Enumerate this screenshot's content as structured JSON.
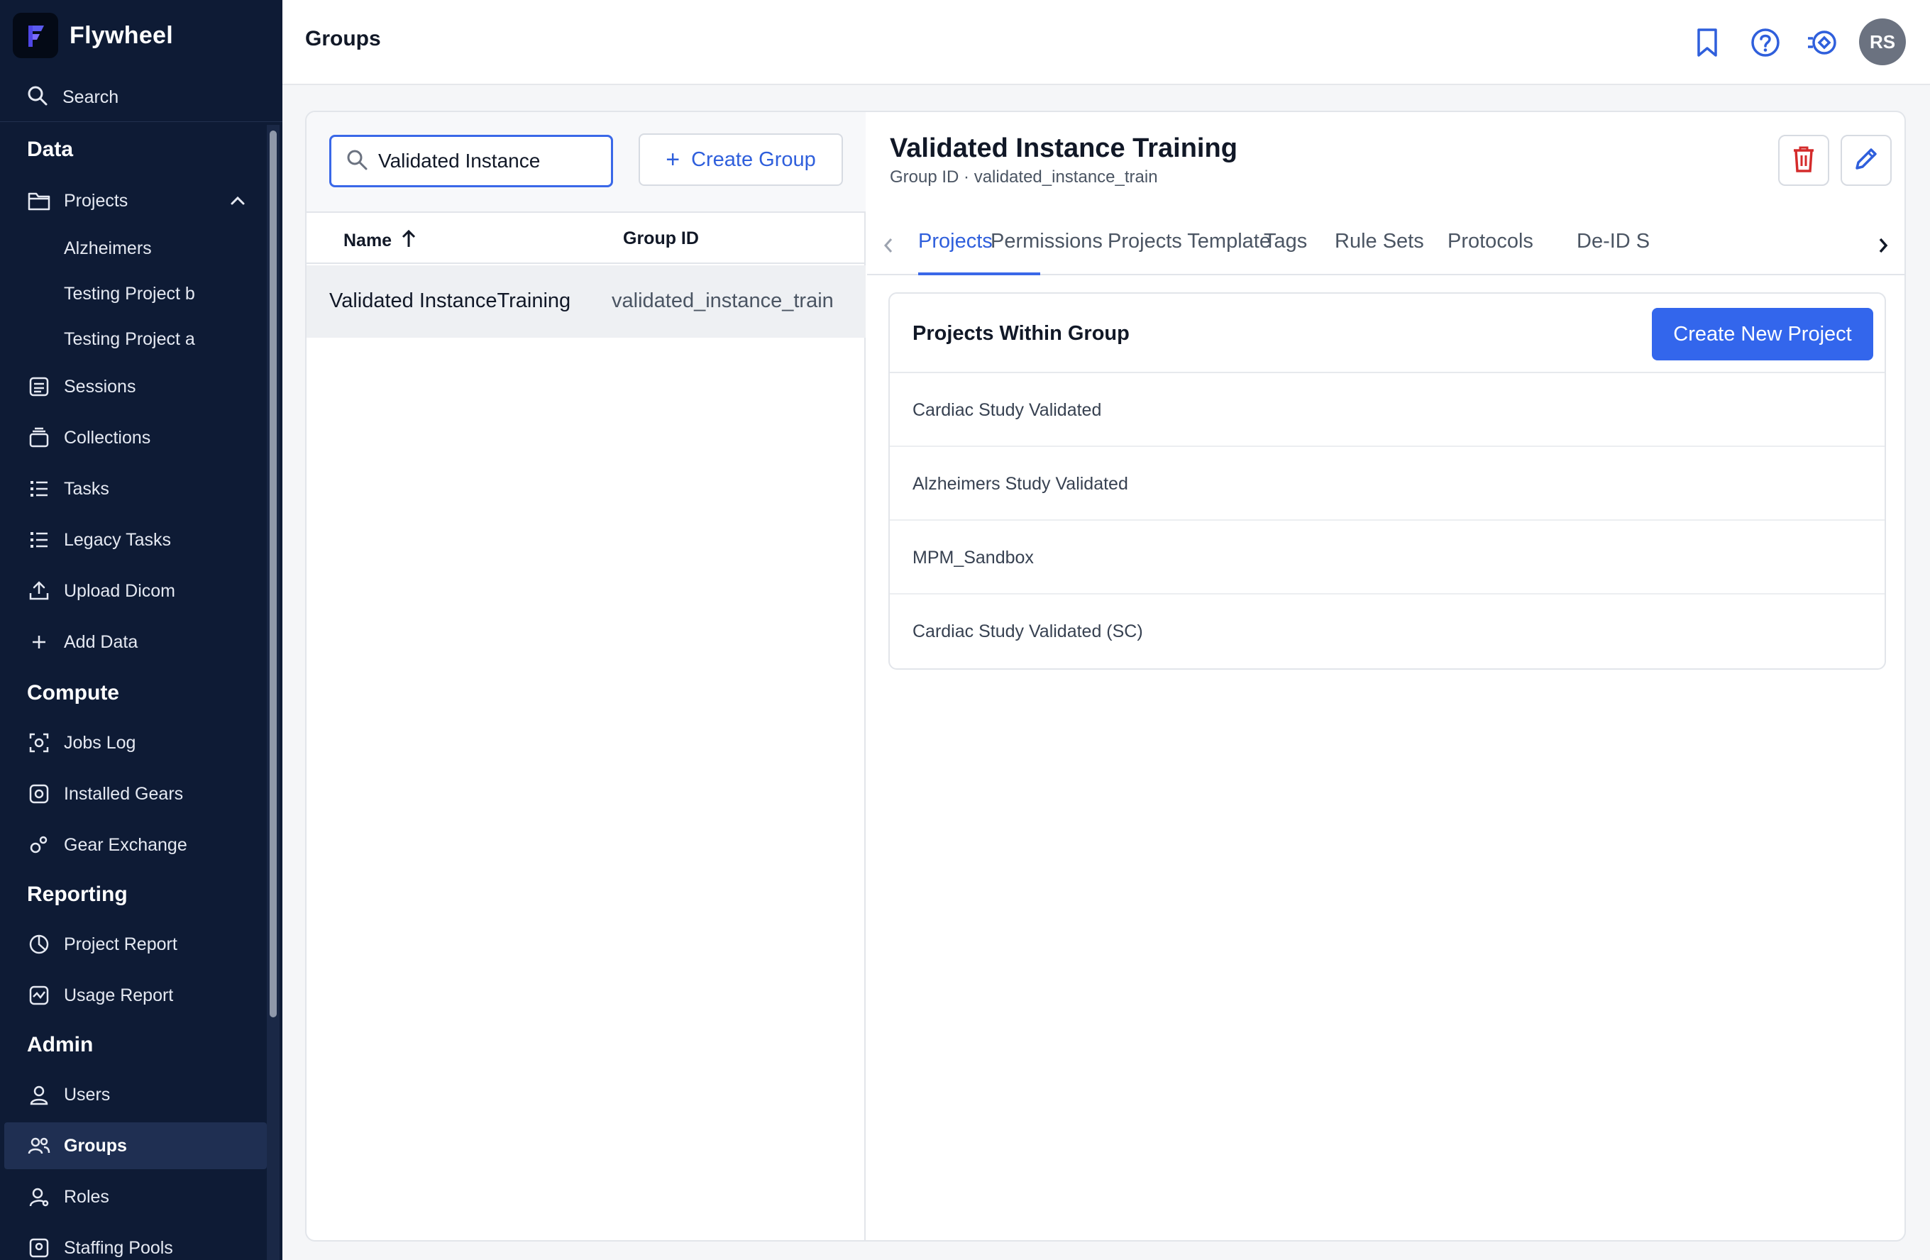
{
  "brand": {
    "name": "Flywheel"
  },
  "header": {
    "title": "Groups",
    "avatar_initials": "RS"
  },
  "sidebar": {
    "search_label": "Search",
    "sections": {
      "data": "Data",
      "compute": "Compute",
      "reporting": "Reporting",
      "admin": "Admin"
    },
    "items": {
      "projects": "Projects",
      "alzheimers": "Alzheimers",
      "testing_b": "Testing Project b",
      "testing_a": "Testing Project a",
      "sessions": "Sessions",
      "collections": "Collections",
      "tasks": "Tasks",
      "legacy_tasks": "Legacy Tasks",
      "upload_dicom": "Upload Dicom",
      "add_data": "Add Data",
      "jobs_log": "Jobs Log",
      "installed_gears": "Installed Gears",
      "gear_exchange": "Gear Exchange",
      "project_report": "Project Report",
      "usage_report": "Usage Report",
      "users": "Users",
      "groups": "Groups",
      "roles": "Roles",
      "staffing_pools": "Staffing Pools"
    },
    "active_item": "groups"
  },
  "groups_list": {
    "search_value": "Validated Instance",
    "create_label": "Create Group",
    "columns": {
      "name": "Name",
      "group_id": "Group ID"
    },
    "sort_indicator": "ascending",
    "rows": [
      {
        "name": "Validated InstanceTraining",
        "group_id": "validated_instance_train"
      }
    ]
  },
  "detail": {
    "title": "Validated Instance Training",
    "subtitle": "Group ID · validated_instance_train",
    "tabs": [
      "Projects",
      "Permissions",
      "Projects Template",
      "Tags",
      "Rule Sets",
      "Protocols",
      "De-ID S"
    ],
    "active_tab": "Projects",
    "projects_card": {
      "title": "Projects Within Group",
      "create_label": "Create New Project",
      "projects": [
        "Cardiac Study Validated",
        "Alzheimers Study Validated",
        "MPM_Sandbox",
        "Cardiac Study Validated (SC)"
      ]
    }
  },
  "colors": {
    "sidebar_bg": "#0e1b35",
    "accent": "#3366ec",
    "delete": "#d42b2b"
  }
}
